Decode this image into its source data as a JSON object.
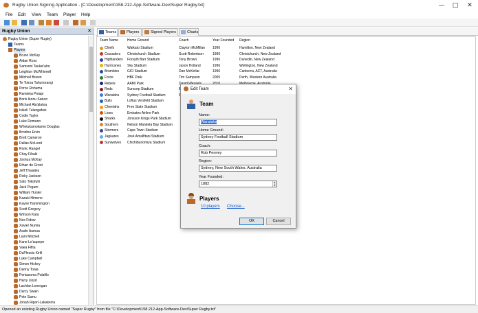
{
  "window": {
    "title": "Rugby Union Signing Application - [C:\\Development\\158.212-App-Software-Dev\\Super Rugby.txt]",
    "minimize": "—",
    "maximize": "□",
    "close": "✕"
  },
  "menu": [
    "File",
    "Edit",
    "View",
    "Team",
    "Player",
    "Help"
  ],
  "toolbar_icons": [
    "new-icon",
    "open-icon",
    "save-icon",
    "save-as-icon",
    "edit-icon",
    "pencil-icon",
    "delete-icon",
    "undo-icon",
    "add-player-icon",
    "edit-player-icon",
    "delete-player-icon"
  ],
  "left_panel": {
    "header": "Rugby Union",
    "close": "✕",
    "tree": {
      "root": "Rugby Union (Super Rugby)",
      "teams": "Teams",
      "players": "Players",
      "player_list": [
        "Bruno McKay",
        "Aidan Ross",
        "Samsoni Taukei'aho",
        "Leighton McWhinnell",
        "Mitchell Brown",
        "Te Toiroa Tahuriorangi",
        "Pirrce Rohuma",
        "Ramieka Potapi",
        "Boris Ikonu Saturo",
        "Michael Ala'alatoa",
        "Isikeli Tulungafusi",
        "Codie Taylor",
        "Luke Romano",
        "Whetukamokamo Douglas",
        "Brodine Ervin",
        "Brett Cameron",
        "Dallas McLeod",
        "Ronic Rangel",
        "Chay Fihaki",
        "Joshua McKay",
        "Ethan de Groot",
        "Jeff Thwaites",
        "Ricky Jackson",
        "Sato Tokofuhi",
        "Jack Pegum",
        "William Hunter",
        "Kazuki Himeno",
        "Kayne Hammington",
        "Scott Gregory",
        "Winson Kata",
        "Nox Fidow",
        "Xavier Numia",
        "Asafo Aumua",
        "Liam Mitchell",
        "Kane Le'aupepe",
        "Vaea Fifita",
        "DuPlessis Kirifi",
        "Luke Campbell",
        "Simon Hickey",
        "Danny Toala",
        "Peniasoma Pulafilo",
        "Harry Lloyd",
        "Lachlan Lonergan",
        "Darcy Swain",
        "Pete Samu",
        "Jonah Ripori-Lakakerra"
      ]
    }
  },
  "tabs": [
    {
      "label": "Teams",
      "active": true
    },
    {
      "label": "Players",
      "active": false
    },
    {
      "label": "Signed Players",
      "active": false
    },
    {
      "label": "Charts",
      "active": false
    }
  ],
  "grid": {
    "columns": [
      "Team Name",
      "Home Ground",
      "Coach",
      "Year Founded",
      "Region"
    ],
    "rows": [
      [
        "Chiefs",
        "Waikato Stadium",
        "Clayton McMillan",
        "1996",
        "Hamilton, New Zealand"
      ],
      [
        "Crusaders",
        "Christchurch Stadium",
        "Scott Robertson",
        "1996",
        "Christchurch, New Zealand"
      ],
      [
        "Highlanders",
        "Forsyth Barr Stadium",
        "Tony Brown",
        "1996",
        "Dunedin, New Zealand"
      ],
      [
        "Hurricanes",
        "Sky Stadium",
        "Jason Holland",
        "1996",
        "Wellington, New Zealand"
      ],
      [
        "Brumbies",
        "GIO Stadium",
        "Dan McKellar",
        "1996",
        "Canberra, ACT, Australia"
      ],
      [
        "Force",
        "HBF Park",
        "Tim Sampson",
        "2005",
        "Perth, Western Australia"
      ],
      [
        "Rebels",
        "AAMI Park",
        "David Wessels",
        "2010",
        "Melbourne, Australia"
      ],
      [
        "Reds",
        "Suncorp Stadium",
        "Brad Thorn",
        "1996",
        "Brisbane, Queensland"
      ],
      [
        "Waratahs",
        "Sydney Football Stadium",
        "Rob Penney",
        "1882",
        "Sydney, New South Wales, Australia"
      ],
      [
        "Bulls",
        "Loftus Versfeld Stadium",
        "",
        "",
        ""
      ],
      [
        "Cheetahs",
        "Free State Stadium",
        "",
        "",
        ""
      ],
      [
        "Lions",
        "Emirates Airline Park",
        "",
        "",
        ""
      ],
      [
        "Sharks",
        "Jonsson Kings Park Stadium",
        "",
        "",
        ""
      ],
      [
        "Southern",
        "Nelson Mandela Bay Stadium",
        "",
        "",
        ""
      ],
      [
        "Stormers",
        "Cape Town Stadium",
        "",
        "",
        ""
      ],
      [
        "Jaguares",
        "José Amalfitani Stadium",
        "",
        "",
        ""
      ],
      [
        "Sunwolves",
        "Chichibunomiya Stadium",
        "",
        "",
        ""
      ]
    ],
    "icon_colors": [
      "#d4a017",
      "#c0392b",
      "#2c3e91",
      "#e6b800",
      "#1f4e9c",
      "#2e7d32",
      "#1a237e",
      "#8b1a1a",
      "#3a7bd5",
      "#1565c0",
      "#f39c12",
      "#d35400",
      "#111111",
      "#e67e22",
      "#2a4b8d",
      "#5dade2",
      "#c0392b"
    ]
  },
  "dialog": {
    "title": "Edit Team",
    "close": "✕",
    "team_heading": "Team",
    "name_label": "Name:",
    "name_value": "Waratahs",
    "ground_label": "Home Ground:",
    "ground_value": "Sydney Football Stadium",
    "coach_label": "Coach:",
    "coach_value": "Rob Penney",
    "region_label": "Region:",
    "region_value": "Sydney, New South Wales, Australia",
    "year_label": "Year Founded:",
    "year_value": "1882",
    "players_heading": "Players",
    "players_link": "10 players",
    "choose_link": "Choose...",
    "ok": "OK",
    "cancel": "Cancel"
  },
  "status": "Opened an existing Rugby Union named \"Super Rugby\" from file \"C:\\Development\\158.212-App-Software-Dev\\Super Rugby.txt\""
}
